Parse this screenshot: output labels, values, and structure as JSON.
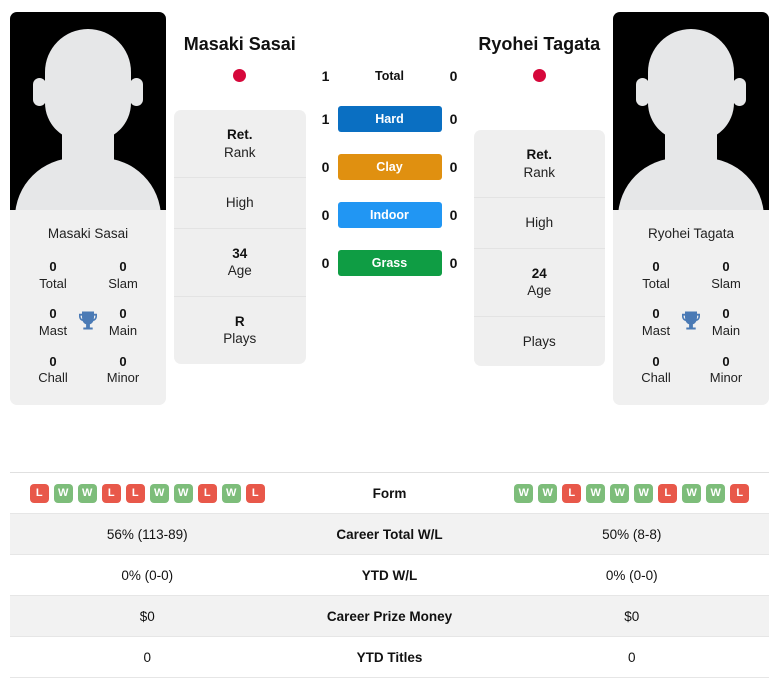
{
  "players": {
    "left": {
      "name": "Masaki Sasai",
      "photo_caption": "Masaki Sasai",
      "flag_color": "#d6083b",
      "titles": [
        [
          {
            "value": "0",
            "label": "Total"
          },
          {
            "value": "0",
            "label": "Slam"
          }
        ],
        [
          {
            "value": "0",
            "label": "Mast"
          },
          {
            "value": "0",
            "label": "Main"
          }
        ],
        [
          {
            "value": "0",
            "label": "Chall"
          },
          {
            "value": "0",
            "label": "Minor"
          }
        ]
      ],
      "info": [
        {
          "value": "Ret.",
          "label": "Rank"
        },
        {
          "value": "",
          "label": "High"
        },
        {
          "value": "34",
          "label": "Age"
        },
        {
          "value": "R",
          "label": "Plays"
        }
      ],
      "form": [
        "L",
        "W",
        "W",
        "L",
        "L",
        "W",
        "W",
        "L",
        "W",
        "L"
      ],
      "career_total_wl": "56% (113-89)",
      "ytd_wl": "0% (0-0)",
      "career_prize_money": "$0",
      "ytd_titles": "0"
    },
    "right": {
      "name": "Ryohei Tagata",
      "photo_caption": "Ryohei Tagata",
      "flag_color": "#d6083b",
      "titles": [
        [
          {
            "value": "0",
            "label": "Total"
          },
          {
            "value": "0",
            "label": "Slam"
          }
        ],
        [
          {
            "value": "0",
            "label": "Mast"
          },
          {
            "value": "0",
            "label": "Main"
          }
        ],
        [
          {
            "value": "0",
            "label": "Chall"
          },
          {
            "value": "0",
            "label": "Minor"
          }
        ]
      ],
      "info": [
        {
          "value": "Ret.",
          "label": "Rank"
        },
        {
          "value": "",
          "label": "High"
        },
        {
          "value": "24",
          "label": "Age"
        },
        {
          "value": "",
          "label": "Plays"
        }
      ],
      "form": [
        "W",
        "W",
        "L",
        "W",
        "W",
        "W",
        "L",
        "W",
        "W",
        "L"
      ],
      "career_total_wl": "50% (8-8)",
      "ytd_wl": "0% (0-0)",
      "career_prize_money": "$0",
      "ytd_titles": "0"
    }
  },
  "head_to_head": [
    {
      "label": "Total",
      "left": "1",
      "right": "0",
      "type": "plain",
      "color": ""
    },
    {
      "label": "Hard",
      "left": "1",
      "right": "0",
      "type": "surface",
      "color": "#0a6fc2"
    },
    {
      "label": "Clay",
      "left": "0",
      "right": "0",
      "type": "surface",
      "color": "#e09010"
    },
    {
      "label": "Indoor",
      "left": "0",
      "right": "0",
      "type": "surface",
      "color": "#2196f3"
    },
    {
      "label": "Grass",
      "left": "0",
      "right": "0",
      "type": "surface",
      "color": "#0f9d44"
    }
  ],
  "table_labels": {
    "form": "Form",
    "career_total_wl": "Career Total W/L",
    "ytd_wl": "YTD W/L",
    "career_prize_money": "Career Prize Money",
    "ytd_titles": "YTD Titles"
  }
}
